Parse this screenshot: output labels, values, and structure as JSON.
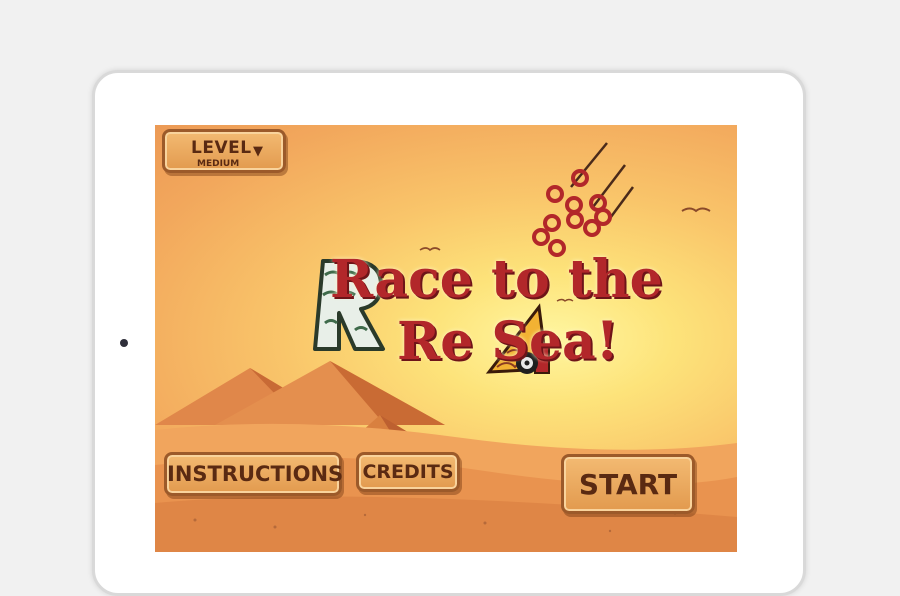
{
  "game": {
    "title_line1": "Race to the",
    "title_line2": "Re  Sea!"
  },
  "menu": {
    "level_label": "LEVEL",
    "level_value": "MEDIUM",
    "instructions_label": "INSTRUCTIONS",
    "credits_label": "CREDITS",
    "start_label": "START"
  },
  "colors": {
    "sky_center": "#fff6a0",
    "sky_edge": "#ec9a55",
    "title_red": "#b2272a",
    "button_fill": "#e9a35a",
    "button_text": "#5a2a12"
  },
  "icons": [
    "chevron-down-icon",
    "chariot-icon",
    "wheel-icon",
    "bird-icon"
  ]
}
